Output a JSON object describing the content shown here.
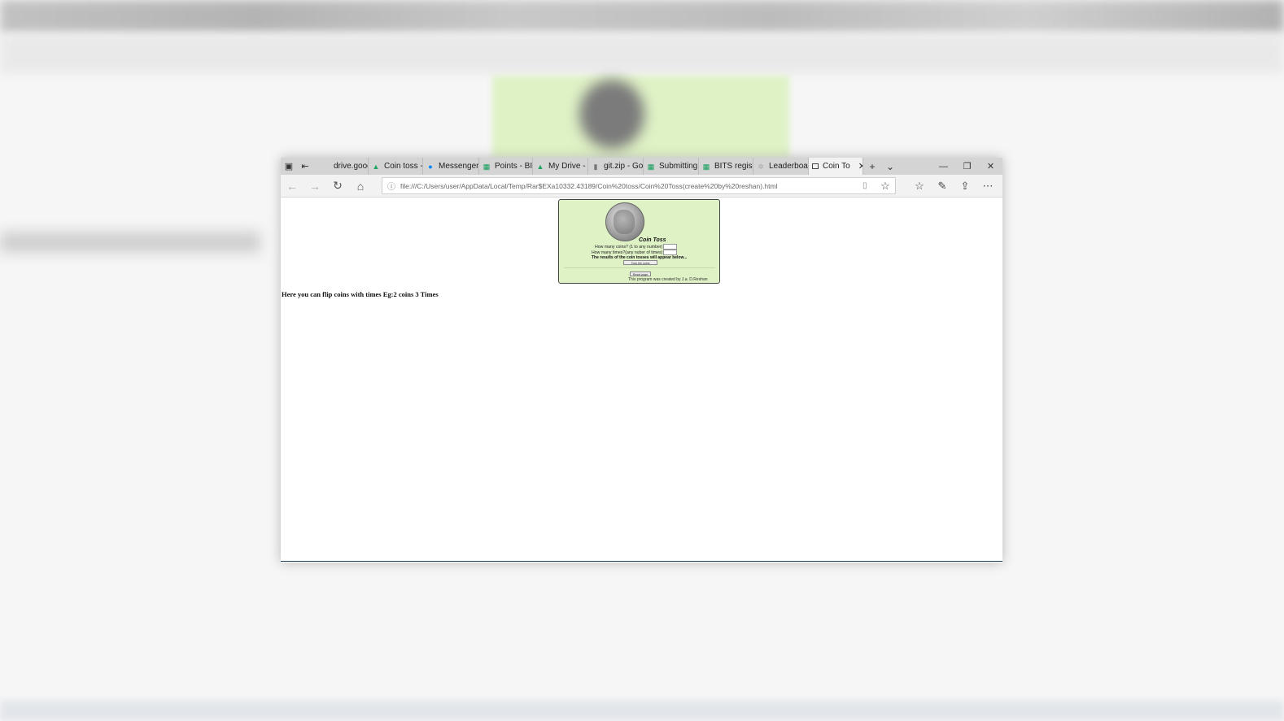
{
  "browser": {
    "tabs": [
      {
        "label": "drive.googl",
        "icon": "blank"
      },
      {
        "label": "Coin toss -",
        "icon": "google-drive-icon"
      },
      {
        "label": "Messenger",
        "icon": "messenger-icon"
      },
      {
        "label": "Points - BIT",
        "icon": "sheets-icon"
      },
      {
        "label": "My Drive -",
        "icon": "google-drive-icon"
      },
      {
        "label": "git.zip - Go",
        "icon": "file-icon"
      },
      {
        "label": "Submitting",
        "icon": "sheets-icon"
      },
      {
        "label": "BITS registi",
        "icon": "sheets-icon"
      },
      {
        "label": "Leaderboa",
        "icon": "leaderboard-icon"
      },
      {
        "label": "Coin To",
        "icon": "page-icon",
        "active": true
      }
    ],
    "address": "file:///C:/Users/user/AppData/Local/Temp/Rar$EXa10332.43189/Coin%20toss/Coin%20Toss(create%20by%20reshan).html"
  },
  "coin_toss": {
    "title": "Coin Toss",
    "q_coins": "How many coins? (1 to any number)",
    "q_times": "How many times?(any nuber of times)",
    "results_note": "The results of the coin tosses will appear below...",
    "toss_button": "Toss the coins",
    "reset_button": "Reset page",
    "credit": "This program was created by J.a. D.Reshan"
  },
  "page": {
    "description": "Here you can flip coins with times Eg:2 coins 3 Times"
  }
}
